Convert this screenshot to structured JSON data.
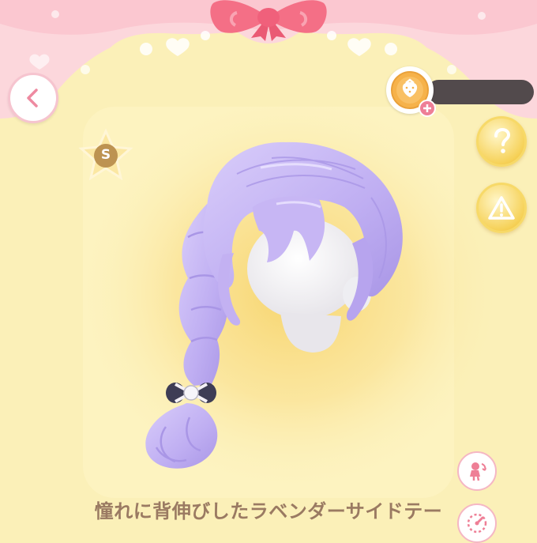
{
  "item": {
    "name": "憧れに背伸びしたラベンダーサイドテー",
    "rarity": "S"
  },
  "toolbar": {
    "back_icon": "back-chevron-icon",
    "help_icon": "question-mark-icon",
    "report_icon": "warning-triangle-icon",
    "pose_icon": "mannequin-pose-icon",
    "extra_icon": "dial-icon"
  },
  "currency": {
    "icon": "strawberry-coin-icon",
    "add_icon": "plus-icon"
  },
  "colors": {
    "background": "#fbf0b8",
    "frame_pink": "#fcd7dc",
    "ribbon": "#f46f86",
    "hair": "#c3b1f2",
    "text": "#9a7a62",
    "button_gold": "#f6d25a"
  }
}
